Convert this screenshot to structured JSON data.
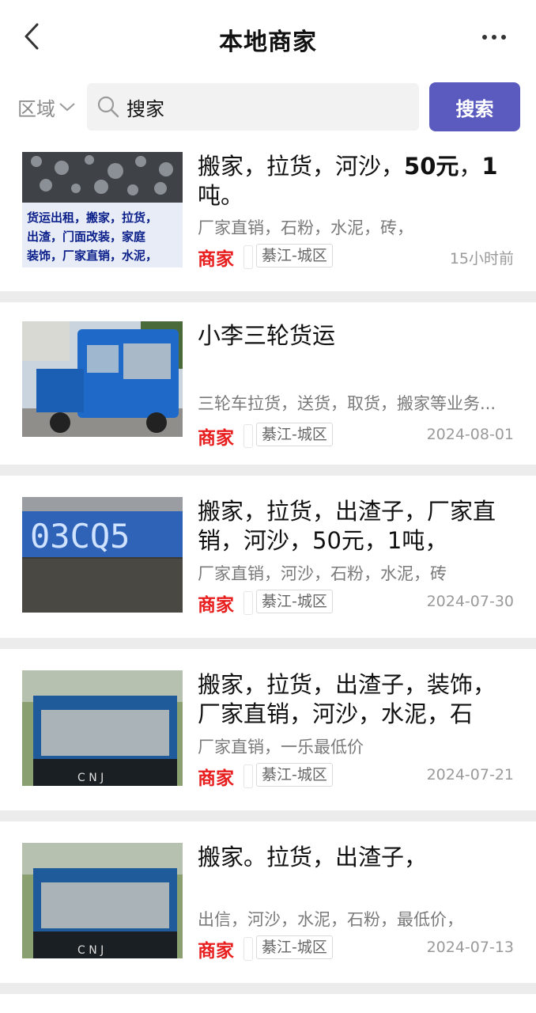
{
  "header": {
    "title": "本地商家",
    "back_icon": "chevron-left-icon",
    "more_icon": "more-dots-icon"
  },
  "search": {
    "region_label": "区域",
    "query": "搜家",
    "button_label": "搜索"
  },
  "listings": [
    {
      "title_parts": [
        "搬家，拉货，河沙，",
        "50元",
        "，",
        "1",
        "吨。"
      ],
      "title": "搬家，拉货，河沙，50元，1吨。",
      "desc": "厂家直销，石粉，水泥，砖，",
      "tag": "商家",
      "area": "綦江-城区",
      "time": "15小时前",
      "thumb_text": "货运出租，搬家，拉货，出渣，门面改装，家庭装饰，厂家直销，水泥，"
    },
    {
      "title": "小李三轮货运",
      "desc": "三轮车拉货，送货，取货，搬家等业务...",
      "tag": "商家",
      "area": "綦江-城区",
      "time": "2024-08-01"
    },
    {
      "title": "搬家，拉货，出渣子，厂家直销，河沙，50元，1吨，",
      "desc": "厂家直销，河沙，石粉，水泥，砖",
      "tag": "商家",
      "area": "綦江-城区",
      "time": "2024-07-30",
      "thumb_text": "03CQ5"
    },
    {
      "title": "搬家，拉货，出渣子，装饰，厂家直销，河沙，水泥，石",
      "desc": "厂家直销，一乐最低价",
      "tag": "商家",
      "area": "綦江-城区",
      "time": "2024-07-21"
    },
    {
      "title": "搬家。拉货，出渣子，",
      "desc": "出信，河沙，水泥，石粉，最低价，",
      "tag": "商家",
      "area": "綦江-城区",
      "time": "2024-07-13"
    }
  ],
  "colors": {
    "accent": "#5b5bbf",
    "merchant_tag": "#e81e1e",
    "separator": "#ececec"
  }
}
